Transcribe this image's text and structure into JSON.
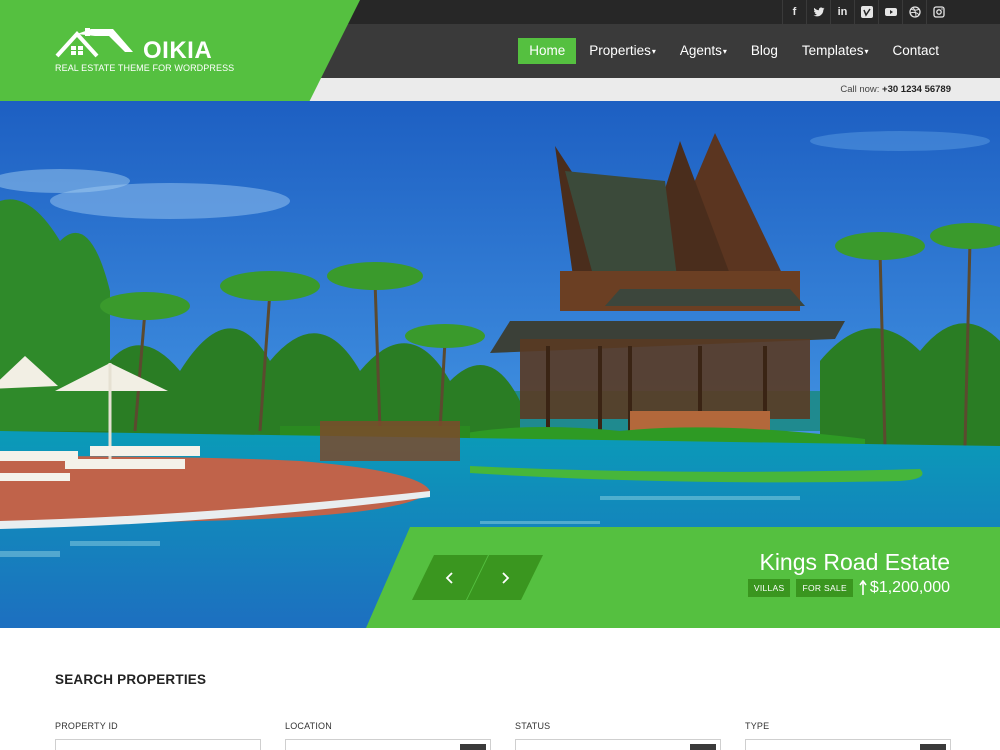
{
  "brand": {
    "name": "OIKIA",
    "tagline": "REAL ESTATE THEME FOR WORDPRESS",
    "accent_color": "#55c040",
    "dark_color": "#3a3a3a"
  },
  "social": {
    "icons": [
      "facebook-icon",
      "twitter-icon",
      "linkedin-icon",
      "vimeo-icon",
      "youtube-icon",
      "dribbble-icon",
      "instagram-icon"
    ],
    "labels": {
      "facebook": "f",
      "linkedin": "in",
      "vimeo": "v",
      "youtube": "▶"
    }
  },
  "nav": {
    "home": "Home",
    "properties": "Properties",
    "agents": "Agents",
    "blog": "Blog",
    "templates": "Templates",
    "contact": "Contact"
  },
  "callnow": {
    "label": "Call now:",
    "phone": "+30 1234 56789"
  },
  "hero": {
    "title": "Kings Road Estate",
    "tags": [
      "VILLAS",
      "FOR SALE"
    ],
    "price": "$1,200,000"
  },
  "search": {
    "title": "SEARCH PROPERTIES",
    "fields": [
      {
        "label": "PROPERTY ID",
        "value": ""
      },
      {
        "label": "LOCATION",
        "value": ""
      },
      {
        "label": "STATUS",
        "value": ""
      },
      {
        "label": "TYPE",
        "value": ""
      }
    ]
  }
}
